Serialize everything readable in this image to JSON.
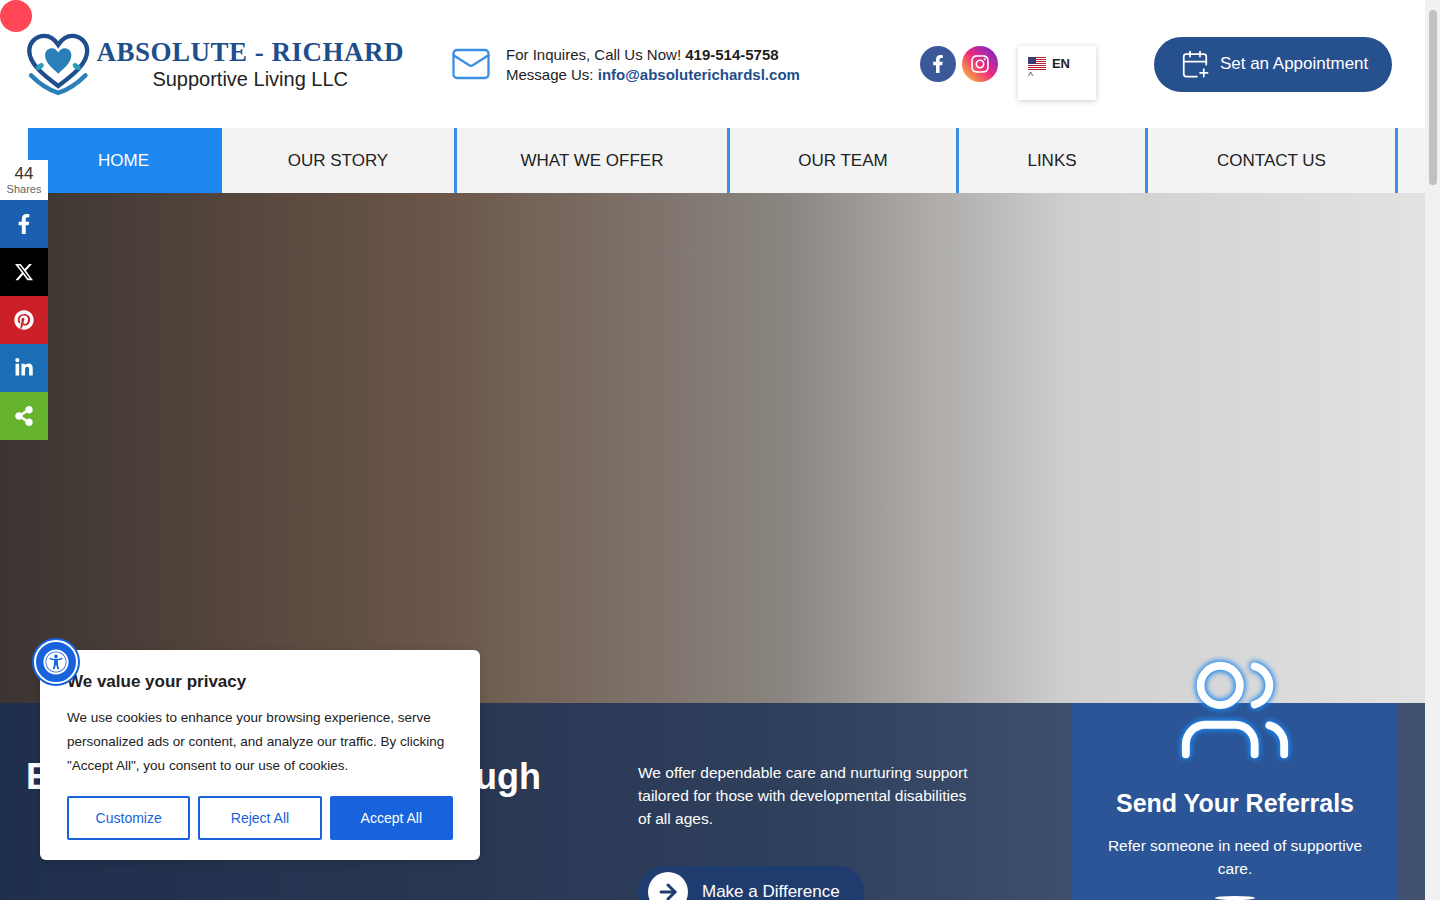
{
  "header": {
    "logo": {
      "title": "ABSOLUTE - RICHARD",
      "subtitle": "Supportive Living LLC"
    },
    "contact": {
      "call_label": "For Inquires, Call Us Now!",
      "phone": "419-514-5758",
      "message_label": "Message Us:",
      "email": "info@absoluterichardsl.com"
    },
    "language": {
      "code": "EN",
      "toggle": "^"
    },
    "appointment_button": "Set an Appointment"
  },
  "nav": [
    {
      "label": "HOME",
      "selected": true
    },
    {
      "label": "OUR STORY",
      "selected": false
    },
    {
      "label": "WHAT WE OFFER",
      "selected": false
    },
    {
      "label": "OUR TEAM",
      "selected": false
    },
    {
      "label": "LINKS",
      "selected": false
    },
    {
      "label": "CONTACT US",
      "selected": false
    }
  ],
  "share_bar": {
    "count": "44",
    "label": "Shares",
    "networks": [
      {
        "kind": "facebook",
        "color": "#1b5fb0"
      },
      {
        "kind": "x",
        "color": "#000000"
      },
      {
        "kind": "pinterest",
        "color": "#cb2027"
      },
      {
        "kind": "linkedin",
        "color": "#1b6eb5"
      },
      {
        "kind": "share",
        "color": "#65b32e"
      }
    ]
  },
  "hero": {
    "heading_start": "E",
    "heading_end": "ugh",
    "text": "We offer dependable care and nurturing support tailored for those with developmental disabilities of all ages.",
    "cta": "Make a Difference",
    "referral": {
      "title": "Send Your Referrals",
      "text": "Refer someone in need of supportive care."
    }
  },
  "cookie_banner": {
    "title": "We value your privacy",
    "text": "We use cookies to enhance your browsing experience, serve personalized ads or content, and analyze our traffic. By clicking \"Accept All\", you consent to our use of cookies.",
    "buttons": [
      {
        "label": "Customize",
        "kind": "outline"
      },
      {
        "label": "Reject All",
        "kind": "outline"
      },
      {
        "label": "Accept All",
        "kind": "primary"
      }
    ]
  }
}
